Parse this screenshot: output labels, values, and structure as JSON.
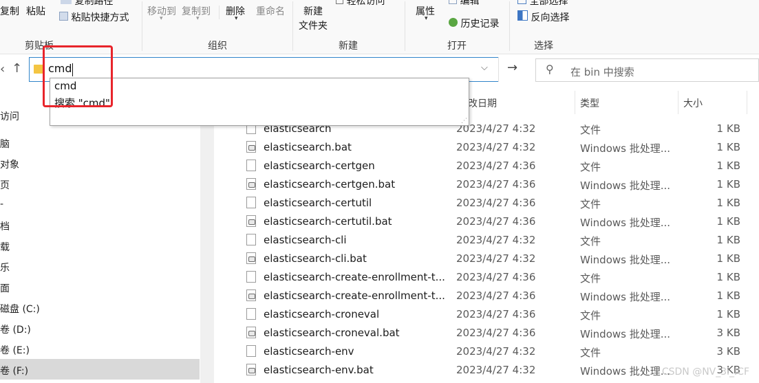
{
  "ribbon": {
    "clipboard": {
      "copy_label": "复制",
      "paste_label": "粘贴",
      "copy_path_label": "复制路径",
      "paste_shortcut_label": "粘贴快捷方式",
      "group_label": "剪贴板"
    },
    "organize": {
      "move_to_label": "移动到",
      "copy_to_label": "复制到",
      "delete_label": "删除",
      "rename_label": "重命名",
      "group_label": "组织"
    },
    "new": {
      "new_folder_line1": "新建",
      "new_folder_line2": "文件夹",
      "easy_access_label": "轻松访问",
      "group_label": "新建"
    },
    "open": {
      "properties_label": "属性",
      "edit_label": "编辑",
      "history_label": "历史记录",
      "group_label": "打开"
    },
    "select": {
      "select_all_label": "全部选择",
      "invert_selection_label": "反向选择",
      "group_label": "选择"
    }
  },
  "address": {
    "value": "cmd",
    "search_placeholder": "在 bin 中搜索"
  },
  "autocomplete": {
    "items": [
      "cmd",
      "搜索 \"cmd\""
    ]
  },
  "nav": {
    "items": [
      "访问",
      "脑",
      "对象",
      "页",
      "-",
      "档",
      "载",
      "乐",
      "面",
      "磁盘 (C:)",
      "卷 (D:)",
      "卷 (E:)",
      "卷 (F:)"
    ]
  },
  "columns": {
    "date": "改日期",
    "type": "类型",
    "size": "大小"
  },
  "files": [
    {
      "name": "elasticsearch",
      "date": "2023/4/27 4:32",
      "type": "文件",
      "size": "1 KB",
      "icon": "file-icon"
    },
    {
      "name": "elasticsearch.bat",
      "date": "2023/4/27 4:32",
      "type": "Windows 批处理...",
      "size": "1 KB",
      "icon": "bat-file-icon"
    },
    {
      "name": "elasticsearch-certgen",
      "date": "2023/4/27 4:36",
      "type": "文件",
      "size": "1 KB",
      "icon": "file-icon"
    },
    {
      "name": "elasticsearch-certgen.bat",
      "date": "2023/4/27 4:36",
      "type": "Windows 批处理...",
      "size": "1 KB",
      "icon": "bat-file-icon"
    },
    {
      "name": "elasticsearch-certutil",
      "date": "2023/4/27 4:36",
      "type": "文件",
      "size": "1 KB",
      "icon": "file-icon"
    },
    {
      "name": "elasticsearch-certutil.bat",
      "date": "2023/4/27 4:36",
      "type": "Windows 批处理...",
      "size": "1 KB",
      "icon": "bat-file-icon"
    },
    {
      "name": "elasticsearch-cli",
      "date": "2023/4/27 4:32",
      "type": "文件",
      "size": "1 KB",
      "icon": "file-icon"
    },
    {
      "name": "elasticsearch-cli.bat",
      "date": "2023/4/27 4:32",
      "type": "Windows 批处理...",
      "size": "1 KB",
      "icon": "bat-file-icon"
    },
    {
      "name": "elasticsearch-create-enrollment-t...",
      "date": "2023/4/27 4:36",
      "type": "文件",
      "size": "1 KB",
      "icon": "file-icon"
    },
    {
      "name": "elasticsearch-create-enrollment-t...",
      "date": "2023/4/27 4:36",
      "type": "Windows 批处理...",
      "size": "1 KB",
      "icon": "bat-file-icon"
    },
    {
      "name": "elasticsearch-croneval",
      "date": "2023/4/27 4:36",
      "type": "文件",
      "size": "1 KB",
      "icon": "file-icon"
    },
    {
      "name": "elasticsearch-croneval.bat",
      "date": "2023/4/27 4:36",
      "type": "Windows 批处理...",
      "size": "3 KB",
      "icon": "bat-file-icon"
    },
    {
      "name": "elasticsearch-env",
      "date": "2023/4/27 4:32",
      "type": "文件",
      "size": "3 KB",
      "icon": "file-icon"
    },
    {
      "name": "elasticsearch-env.bat",
      "date": "2023/4/27 4:32",
      "type": "Windows 批处理...",
      "size": "3 KB",
      "icon": "bat-file-icon"
    }
  ],
  "watermark": "CSDN @NV_3i_ICF",
  "colors": {
    "highlight_red": "#e8242b",
    "address_border": "#2f84c9"
  }
}
